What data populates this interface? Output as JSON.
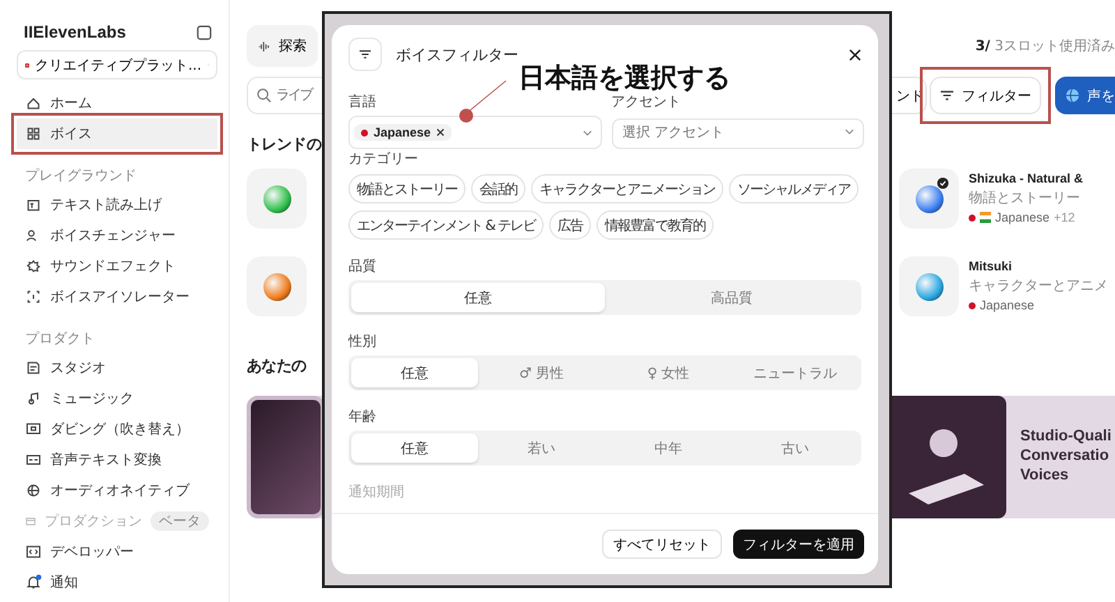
{
  "sidebar": {
    "logo": "IIElevenLabs",
    "workspace": "クリエイティブプラット...",
    "nav": [
      {
        "kind": "item",
        "label": "ホーム",
        "selected": false,
        "highlighted": false,
        "dimmed": false
      },
      {
        "kind": "item",
        "label": "ボイス",
        "selected": true,
        "highlighted": true,
        "dimmed": false
      },
      {
        "kind": "section",
        "label": "プレイグラウンド"
      },
      {
        "kind": "item",
        "label": "テキスト読み上げ",
        "selected": false,
        "highlighted": false,
        "dimmed": false
      },
      {
        "kind": "item",
        "label": "ボイスチェンジャー",
        "selected": false,
        "highlighted": false,
        "dimmed": false
      },
      {
        "kind": "item",
        "label": "サウンドエフェクト",
        "selected": false,
        "highlighted": false,
        "dimmed": false
      },
      {
        "kind": "item",
        "label": "ボイスアイソレーター",
        "selected": false,
        "highlighted": false,
        "dimmed": false
      },
      {
        "kind": "section",
        "label": "プロダクト"
      },
      {
        "kind": "item",
        "label": "スタジオ",
        "selected": false,
        "highlighted": false,
        "dimmed": false
      },
      {
        "kind": "item",
        "label": "ミュージック",
        "selected": false,
        "highlighted": false,
        "dimmed": false
      },
      {
        "kind": "item",
        "label": "ダビング（吹き替え）",
        "selected": false,
        "highlighted": false,
        "dimmed": false
      },
      {
        "kind": "item",
        "label": "音声テキスト変換",
        "selected": false,
        "highlighted": false,
        "dimmed": false
      },
      {
        "kind": "item",
        "label": "オーディオネイティブ",
        "selected": false,
        "highlighted": false,
        "dimmed": false
      },
      {
        "kind": "item",
        "label": "プロダクション",
        "badge": "ベータ",
        "selected": false,
        "highlighted": false,
        "dimmed": true
      },
      {
        "kind": "item",
        "label": "デベロッパー",
        "selected": false,
        "highlighted": false,
        "dimmed": false
      },
      {
        "kind": "item",
        "label": "通知",
        "selected": false,
        "highlighted": false,
        "dimmed": false,
        "notification": true
      }
    ]
  },
  "main": {
    "explore_tab": "探索",
    "slots": "**3/** 3スロット使用済み",
    "search_placeholder": "ライブ",
    "toolbar_buttons": [
      {
        "kind": "outline",
        "label": "ンド"
      },
      {
        "kind": "filter",
        "label": "フィルター",
        "highlighted": true
      },
      {
        "kind": "primary",
        "label": "声を"
      }
    ],
    "trending_heading": "トレンドの",
    "voices": [
      {
        "name": "Shizuka - Natural &",
        "category": "物語とストーリー",
        "language": "Japanese",
        "extra": "+12",
        "verified": true
      },
      {
        "name": "Mitsuki",
        "category": "キャラクターとアニメ",
        "language": "Japanese",
        "verified": false
      }
    ],
    "your_heading": "あなたの",
    "banner": {
      "lines": [
        "Studio-Quali",
        "Conversatio",
        "Voices"
      ]
    }
  },
  "modal": {
    "title": "ボイスフィルター",
    "language": {
      "label": "言語",
      "chip": "Japanese"
    },
    "accent": {
      "label": "アクセント",
      "placeholder": "選択 アクセント"
    },
    "categories": {
      "label": "カテゴリー",
      "items": [
        "物語とストーリー",
        "会話的",
        "キャラクターとアニメーション",
        "ソーシャルメディア",
        "エンターテインメント & テレビ",
        "広告",
        "情報豊富で教育的"
      ]
    },
    "segments": [
      {
        "label": "品質",
        "options": [
          {
            "label": "任意",
            "selected": true
          },
          {
            "label": "高品質",
            "selected": false
          }
        ]
      },
      {
        "label": "性別",
        "options": [
          {
            "label": "任意",
            "selected": true
          },
          {
            "symbol": "♂",
            "label": "男性",
            "selected": false
          },
          {
            "symbol": "♀",
            "label": "女性",
            "selected": false
          },
          {
            "label": "ニュートラル",
            "selected": false
          }
        ]
      },
      {
        "label": "年齢",
        "options": [
          {
            "label": "任意",
            "selected": true
          },
          {
            "label": "若い",
            "selected": false
          },
          {
            "label": "中年",
            "selected": false
          },
          {
            "label": "古い",
            "selected": false
          }
        ]
      }
    ],
    "cut_label": "通知期間",
    "buttons": [
      {
        "kind": "secondary",
        "label": "すべてリセット"
      },
      {
        "kind": "primary",
        "label": "フィルターを適用"
      }
    ]
  },
  "annotation": {
    "callout": "日本語を選択する"
  }
}
